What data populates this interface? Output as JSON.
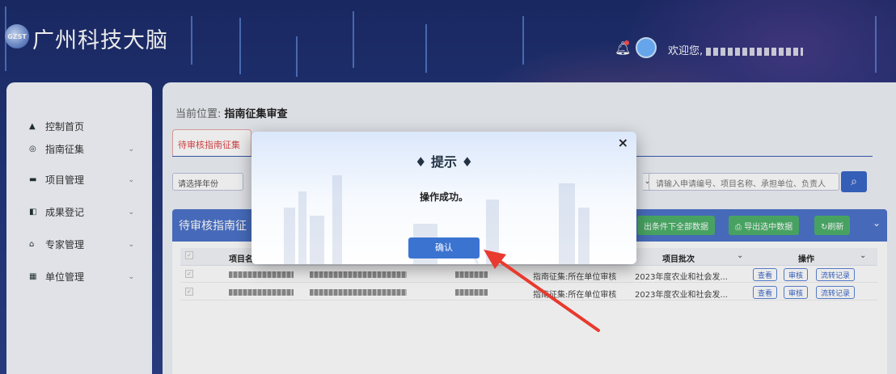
{
  "header": {
    "logo_text": "GZST",
    "brand": "广州科技大脑",
    "welcome": "欢迎您,"
  },
  "sidebar": {
    "items": [
      {
        "label": "控制首页",
        "icon": "home-icon",
        "glyph": "▲"
      },
      {
        "label": "指南征集",
        "icon": "location-icon",
        "glyph": "◎"
      },
      {
        "label": "项目管理",
        "icon": "folder-icon",
        "glyph": "▬"
      },
      {
        "label": "成果登记",
        "icon": "copy-icon",
        "glyph": "◧"
      },
      {
        "label": "专家管理",
        "icon": "graduation-cap-icon",
        "glyph": "⌂"
      },
      {
        "label": "单位管理",
        "icon": "building-icon",
        "glyph": "▦"
      }
    ]
  },
  "breadcrumb": {
    "prefix": "当前位置:",
    "current": "指南征集审查"
  },
  "tab": {
    "label": "待审核指南征集"
  },
  "filters": {
    "year_placeholder": "请选择年份",
    "search_placeholder": "请输入申请编号、项目名称、承担单位、负责人"
  },
  "panel": {
    "title": "待审核指南征",
    "export_all": "出条件下全部数据",
    "export_selected": "导出选中数据",
    "refresh": "刷新"
  },
  "table": {
    "headers": {
      "name": "项目名",
      "batch": "项目批次",
      "ops": "操作"
    },
    "rows": [
      {
        "status": "指南征集:所在单位审核",
        "batch": "2023年度农业和社会发..."
      },
      {
        "status": "指南征集:所在单位审核",
        "batch": "2023年度农业和社会发..."
      }
    ],
    "ops": {
      "view": "查看",
      "review": "审核",
      "flow": "流转记录"
    }
  },
  "modal": {
    "title": "♦ 提示 ♦",
    "message": "操作成功。",
    "ok": "确认",
    "close": "×"
  },
  "colors": {
    "accent": "#3b73d1",
    "arrow": "#e83a2e",
    "tab_red": "#e04848",
    "green": "#4eb06a"
  }
}
